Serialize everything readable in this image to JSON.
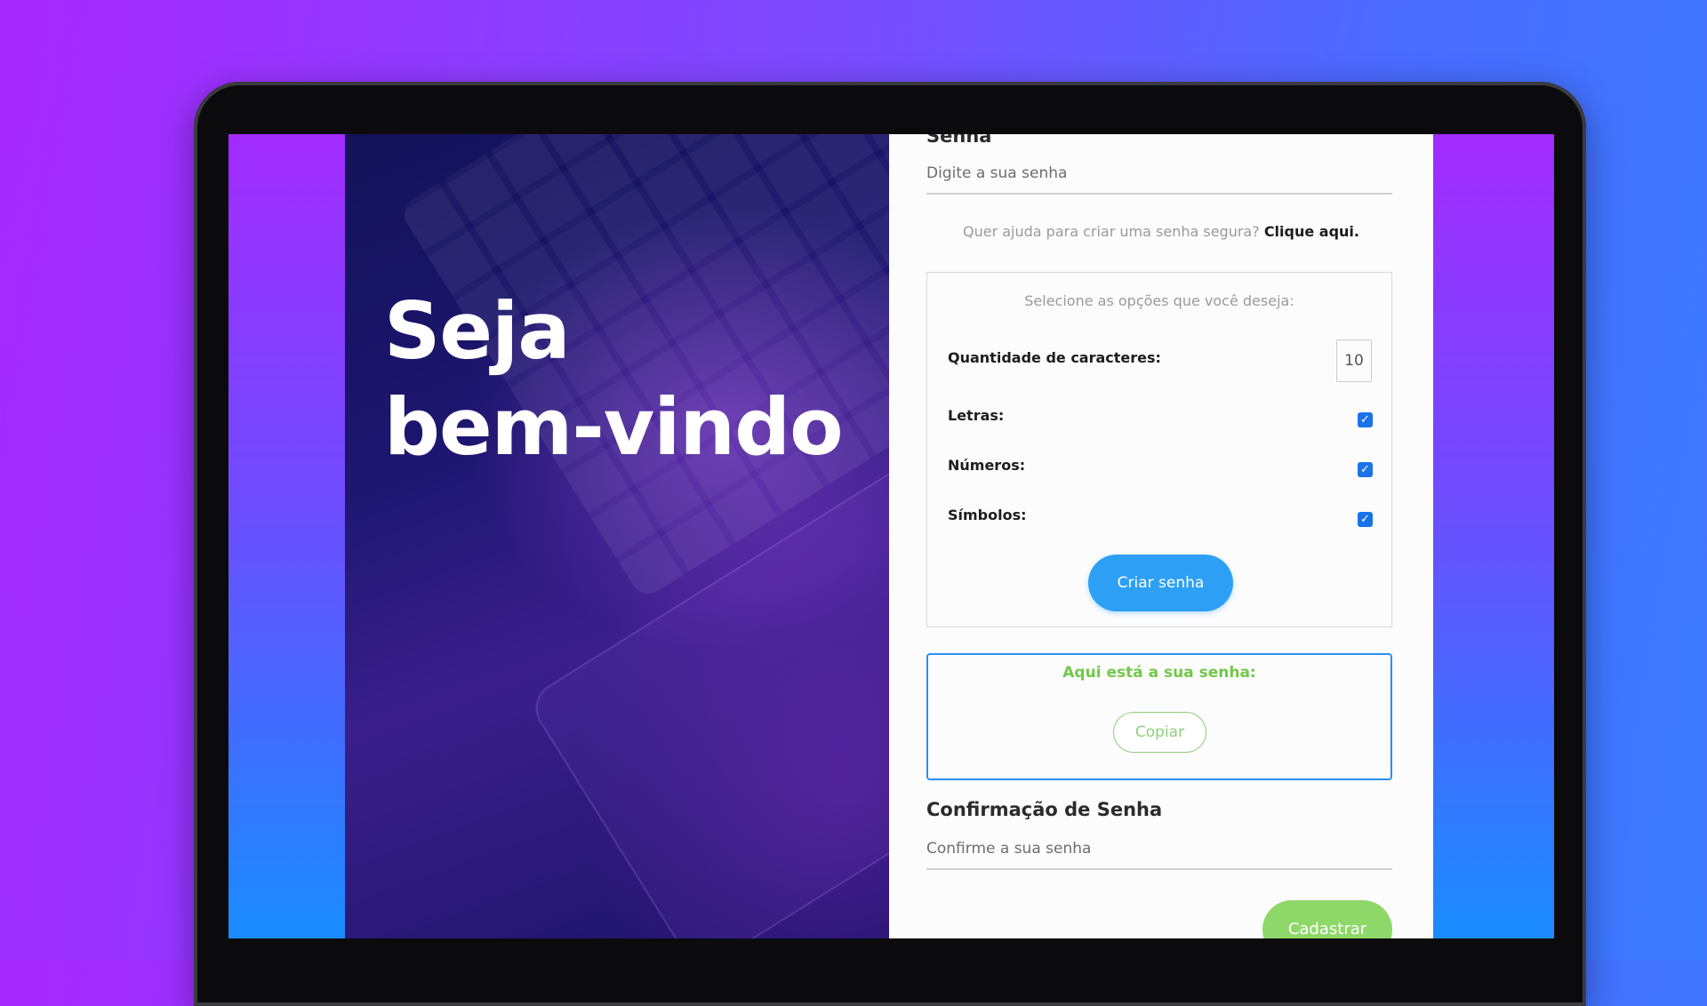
{
  "hero": {
    "title": "Seja\nbem-vindo"
  },
  "form": {
    "password_label": "Senha",
    "password_placeholder": "Digite a sua senha",
    "help_text": "Quer ajuda para criar uma senha segura?",
    "help_link": "Clique aqui.",
    "options": {
      "title": "Selecione as opções que você deseja:",
      "length_label": "Quantidade de caracteres:",
      "length_value": "10",
      "letters_label": "Letras:",
      "letters_checked": true,
      "numbers_label": "Números:",
      "numbers_checked": true,
      "symbols_label": "Símbolos:",
      "symbols_checked": true,
      "create_button": "Criar senha"
    },
    "result": {
      "title": "Aqui está a sua senha:",
      "copy_button": "Copiar"
    },
    "confirm_label": "Confirmação de Senha",
    "confirm_placeholder": "Confirme a sua senha",
    "register_button": "Cadastrar"
  },
  "colors": {
    "accent_blue": "#2da0f5",
    "accent_green": "#8ed86a",
    "checkbox": "#1a73e8"
  }
}
